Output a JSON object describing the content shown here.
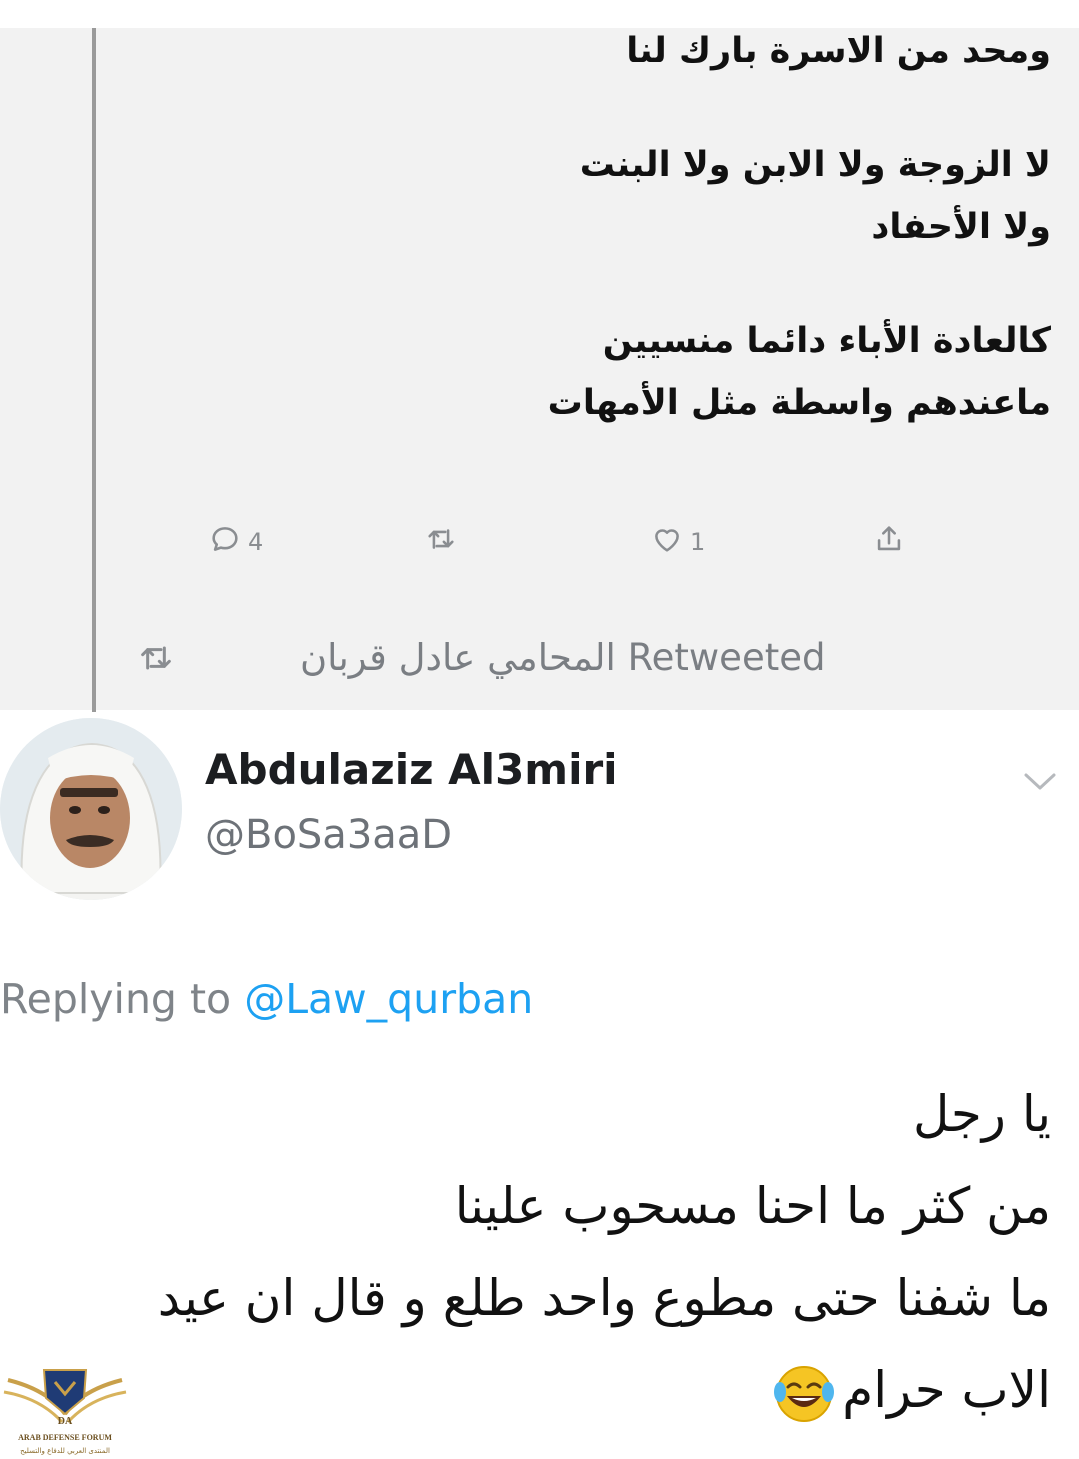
{
  "quoted_tweet": {
    "lines": [
      "ومحد من الاسرة  بارك لنا",
      "",
      "لا الزوجة    ولا الابن    ولا البنت",
      "ولا الأحفاد",
      "",
      "كالعادة الأباء دائما منسيين",
      "ماعندهم واسطة مثل الأمهات"
    ],
    "actions": {
      "reply_count": "4",
      "retweet_count": "",
      "like_count": "1"
    }
  },
  "retweet_banner": {
    "text": "المحامي عادل قربان Retweeted"
  },
  "reply_tweet": {
    "display_name": "Abdulaziz Al3miri",
    "handle": "@BoSa3aaD",
    "replying_prefix": "Replying to ",
    "replying_to": "@Law_qurban",
    "lines": [
      "يا رجل",
      "من كثر ما احنا مسحوب علينا",
      "ما شفنا حتى مطوع واحد طلع و قال ان عيد",
      "الاب حرام"
    ],
    "emoji": "face-with-tears-of-joy"
  },
  "watermark": {
    "logo_letters": "DA",
    "name_en": "ARAB DEFENSE FORUM",
    "name_ar": "المنتدى العربي للدفاع والتسليح"
  },
  "icons": {
    "reply": "speech-bubble-icon",
    "retweet": "retweet-arrows-icon",
    "like": "heart-icon",
    "share": "share-upload-icon",
    "menu": "chevron-down-icon"
  },
  "colors": {
    "upper_background": "#f2f2f2",
    "mention": "#1da1f2",
    "muted": "#7f8489"
  }
}
